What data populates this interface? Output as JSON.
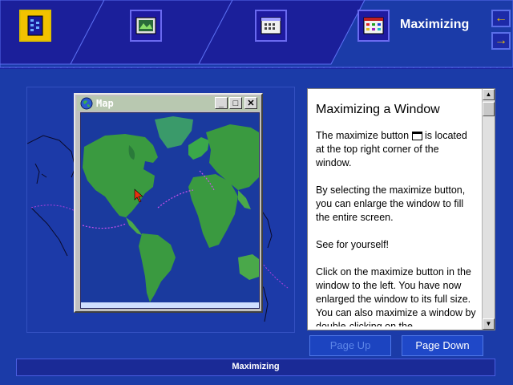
{
  "header": {
    "active_tab_title": "Maximizing",
    "tabs": [
      {
        "icon": "book-icon",
        "active": true
      },
      {
        "icon": "map-picture-icon",
        "active": false
      },
      {
        "icon": "window-calendar-icon",
        "active": false
      },
      {
        "icon": "color-grid-icon",
        "active": false
      }
    ],
    "nav": {
      "back_icon": "arrow-left-icon",
      "forward_icon": "arrow-right-icon"
    }
  },
  "map_window": {
    "title": "Map",
    "controls": {
      "minimize": "_",
      "maximize": "□",
      "close": "✕"
    }
  },
  "lesson": {
    "heading": "Maximizing a Window",
    "para1_before": "The maximize button",
    "para1_after": "is located at the top right corner of the window.",
    "para2": "By selecting the maximize button, you can enlarge the window to fill the entire screen.",
    "para3": "See for yourself!",
    "para4": "Click on the maximize button in the window to the left.  You have now enlarged the window to its full size.  You can also maximize a window by double-clicking on the"
  },
  "buttons": {
    "page_up": "Page Up",
    "page_down": "Page Down"
  },
  "status": {
    "label": "Maximizing"
  },
  "colors": {
    "background": "#1b3ba8",
    "accent_yellow": "#f2c200",
    "ocean": "#1a3a9e",
    "land": "#3a9a40"
  }
}
